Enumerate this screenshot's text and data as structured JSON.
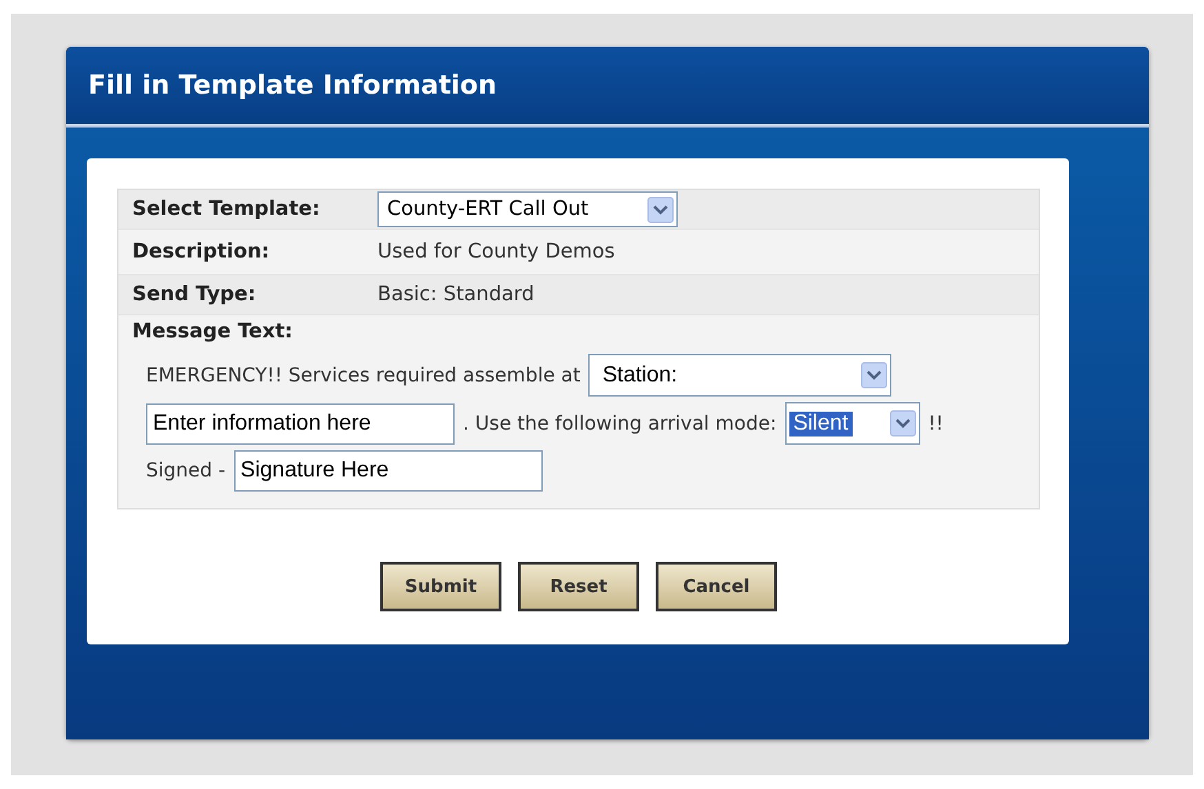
{
  "window": {
    "title": "Fill in Template Information"
  },
  "fields": [
    {
      "kind": "select",
      "label": "Select Template:",
      "value": "County-ERT Call Out"
    },
    {
      "kind": "text",
      "label": "Description:",
      "value": "Used for County Demos"
    },
    {
      "kind": "text",
      "label": "Send Type:",
      "value": "Basic: Standard"
    }
  ],
  "message": {
    "label": "Message Text:",
    "lines": [
      [
        {
          "kind": "text",
          "text": "EMERGENCY!! Services required assemble at"
        },
        {
          "kind": "select",
          "value": "Station:",
          "highlighted": false
        }
      ],
      [
        {
          "kind": "input",
          "value": "Enter information here"
        },
        {
          "kind": "text",
          "text": ". Use the following arrival mode:"
        },
        {
          "kind": "select",
          "value": "Silent",
          "highlighted": true
        },
        {
          "kind": "text",
          "text": "!!"
        }
      ],
      [
        {
          "kind": "text",
          "text": "Signed -"
        },
        {
          "kind": "input",
          "value": "Signature Here"
        }
      ]
    ]
  },
  "buttons": [
    "Submit",
    "Reset",
    "Cancel"
  ]
}
